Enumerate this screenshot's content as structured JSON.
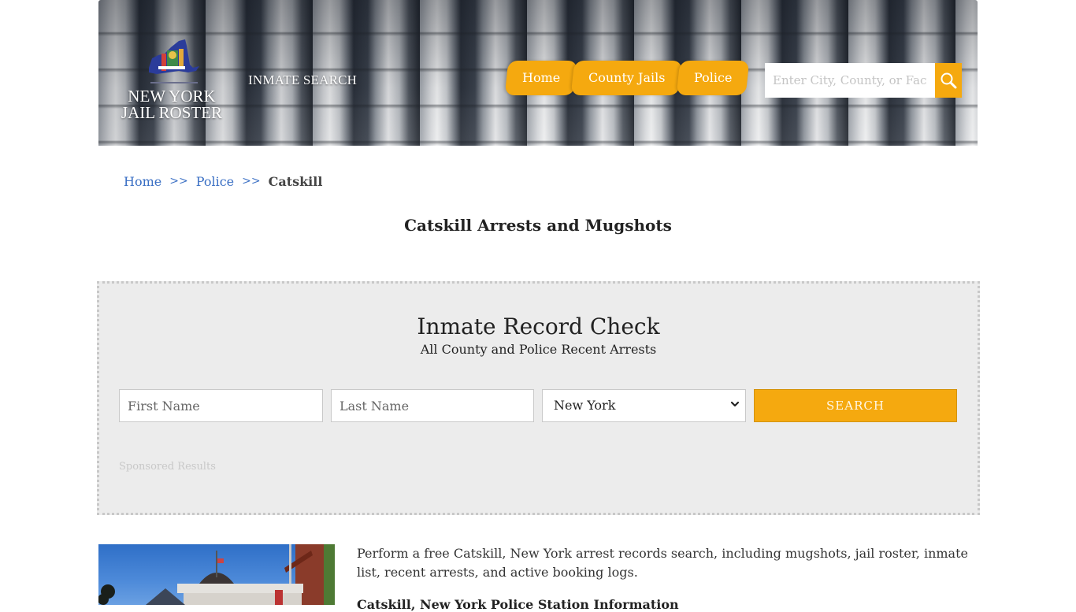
{
  "site": {
    "logo_line1": "NEW YORK",
    "logo_line2": "JAIL ROSTER",
    "inmate_search_link": "INMATE SEARCH"
  },
  "nav": {
    "items": [
      {
        "label": "Home"
      },
      {
        "label": "County Jails"
      },
      {
        "label": "Police"
      }
    ]
  },
  "search": {
    "placeholder": "Enter City, County, or Facility",
    "icon": "search-icon"
  },
  "breadcrumb": {
    "items": [
      {
        "label": "Home"
      },
      {
        "label": "Police"
      }
    ],
    "separator": ">>",
    "current": "Catskill"
  },
  "page": {
    "title": "Catskill Arrests and Mugshots"
  },
  "record_check": {
    "title": "Inmate Record Check",
    "subtitle": "All County and Police Recent Arrests",
    "first_name_placeholder": "First Name",
    "last_name_placeholder": "Last Name",
    "first_name_value": "",
    "last_name_value": "",
    "state_selected": "New York",
    "submit_label": "SEARCH",
    "sponsored_label": "Sponsored Results"
  },
  "content": {
    "intro": "Perform a free Catskill, New York arrest records search, including mugshots, jail roster, inmate list, recent arrests, and active booking logs.",
    "station_heading": "Catskill, New York Police Station Information"
  },
  "colors": {
    "accent": "#f5a90f",
    "link": "#3a6fc4",
    "panel_bg": "#ececec"
  }
}
